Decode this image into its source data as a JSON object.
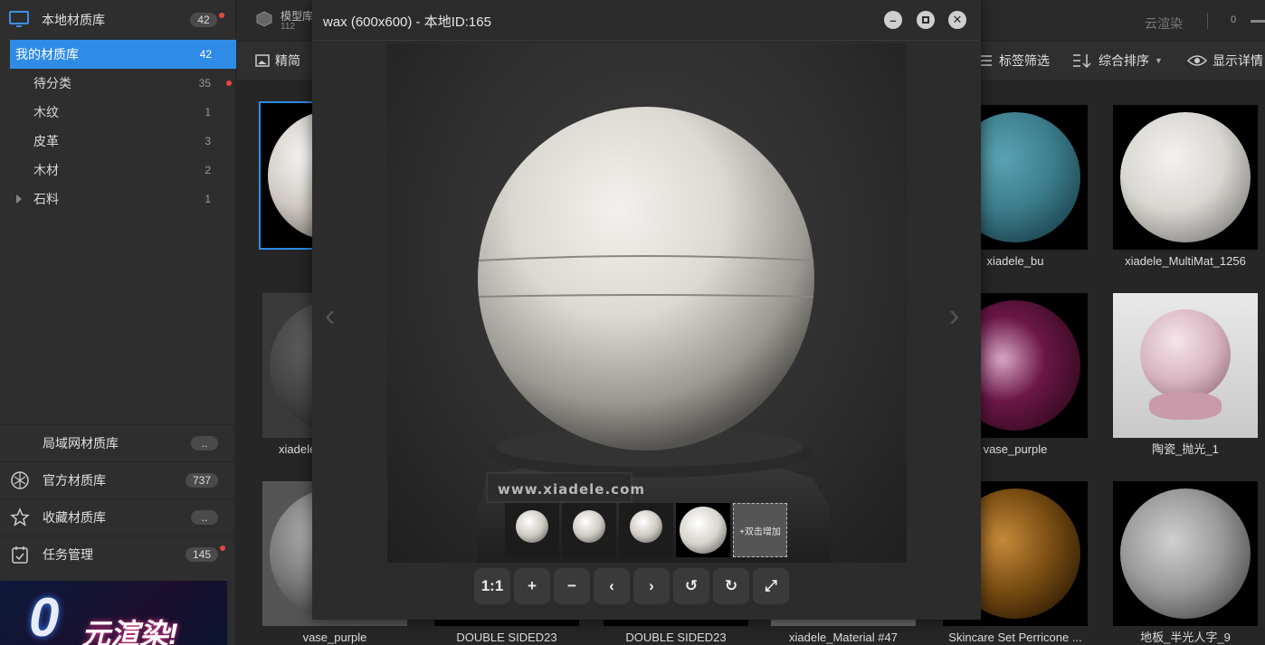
{
  "sidebar": {
    "local_title": "本地材质库",
    "local_count": "42",
    "items": [
      {
        "label": "我的材质库",
        "count": "42"
      },
      {
        "label": "待分类",
        "count": "35"
      },
      {
        "label": "木纹",
        "count": "1"
      },
      {
        "label": "皮革",
        "count": "3"
      },
      {
        "label": "木材",
        "count": "2"
      },
      {
        "label": "石料",
        "count": "1"
      }
    ],
    "sections": [
      {
        "label": "局域网材质库",
        "count": ".."
      },
      {
        "label": "官方材质库",
        "count": "737"
      },
      {
        "label": "收藏材质库",
        "count": ".."
      },
      {
        "label": "任务管理",
        "count": "145"
      }
    ],
    "banner_big": "0",
    "banner_sub": "元渲染!"
  },
  "topbar": {
    "model_lib": "模型库",
    "model_count": "112",
    "cloud_render": "云渲染",
    "zoom_value": "0"
  },
  "toolbar": {
    "simple_mode": "精简",
    "tag_filter": "标签筛选",
    "sort": "综合排序",
    "details": "显示详情"
  },
  "grid": {
    "row1": [
      {
        "caption": "",
        "color": "#e8e4de"
      },
      {
        "caption": "xiadele_bu",
        "color": "#3c7d8c"
      },
      {
        "caption": "xiadele_MultiMat_1256",
        "color": "#d9d7d2"
      }
    ],
    "row2": [
      {
        "caption": "xiadele",
        "color": "#444444"
      },
      {
        "caption": "vase_purple",
        "color": "#6b1748"
      },
      {
        "caption": "陶瓷_抛光_1",
        "color": "#d7b5c0"
      }
    ],
    "row3": [
      {
        "caption": "vase_purple",
        "color": "#666666"
      },
      {
        "caption": "DOUBLE SIDED23",
        "color": "#111111"
      },
      {
        "caption": "DOUBLE SIDED23",
        "color": "#111111"
      },
      {
        "caption": "xiadele_Material #47",
        "color": "#777777"
      },
      {
        "caption": "Skincare Set Perricone ...",
        "color": "#7a4d12"
      },
      {
        "caption": "地板_半光人字_9",
        "color": "#9a9a9a"
      }
    ]
  },
  "dialog": {
    "title": "wax (600x600) - 本地ID:165",
    "watermark": "www.xiadele.com",
    "add_thumb": "+双击增加",
    "controls": {
      "actual_size": "1:1",
      "zoom_in": "+",
      "zoom_out": "−",
      "prev": "‹",
      "next": "›",
      "rotate_left": "↺",
      "rotate_right": "↻",
      "fullscreen": "⤢"
    }
  },
  "colors": {
    "accent": "#2e8ce6",
    "badge_red": "#e64545"
  }
}
